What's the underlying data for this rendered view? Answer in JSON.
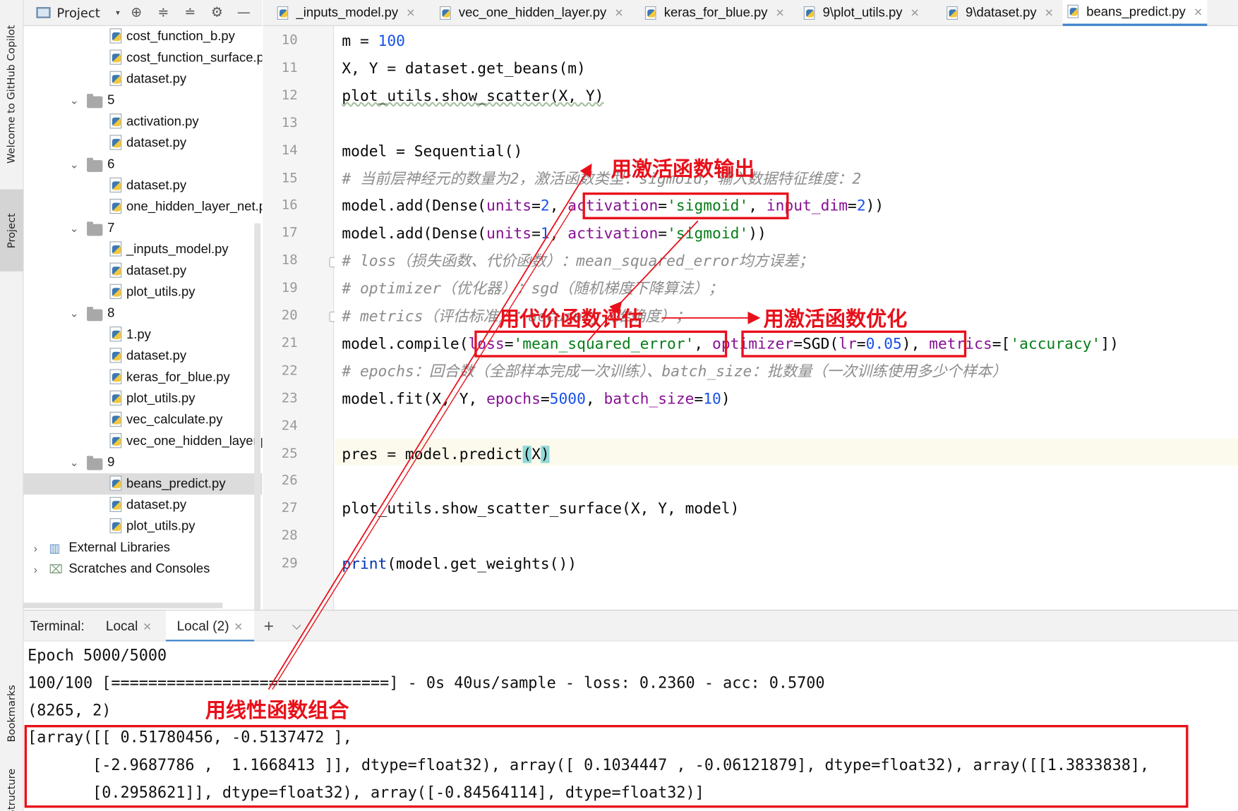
{
  "sidebar_strip": {
    "copilot_label": "Welcome to GitHub Copilot",
    "project_label": "Project",
    "bookmarks_label": "Bookmarks",
    "structure_label": "Structure"
  },
  "project_panel": {
    "title": "Project",
    "toolbar_icons": [
      "crosshair-icon",
      "expand-all-icon",
      "collapse-all-icon",
      "gear-icon",
      "minimize-icon"
    ]
  },
  "tree": [
    {
      "label": "cost_function_b.py",
      "type": "file"
    },
    {
      "label": "cost_function_surface.py",
      "type": "file"
    },
    {
      "label": "dataset.py",
      "type": "file"
    },
    {
      "label": "5",
      "type": "folder"
    },
    {
      "label": "activation.py",
      "type": "file"
    },
    {
      "label": "dataset.py",
      "type": "file"
    },
    {
      "label": "6",
      "type": "folder"
    },
    {
      "label": "dataset.py",
      "type": "file"
    },
    {
      "label": "one_hidden_layer_net.py",
      "type": "file"
    },
    {
      "label": "7",
      "type": "folder"
    },
    {
      "label": "_inputs_model.py",
      "type": "file"
    },
    {
      "label": "dataset.py",
      "type": "file"
    },
    {
      "label": "plot_utils.py",
      "type": "file"
    },
    {
      "label": "8",
      "type": "folder"
    },
    {
      "label": "1.py",
      "type": "file"
    },
    {
      "label": "dataset.py",
      "type": "file"
    },
    {
      "label": "keras_for_blue.py",
      "type": "file"
    },
    {
      "label": "plot_utils.py",
      "type": "file"
    },
    {
      "label": "vec_calculate.py",
      "type": "file"
    },
    {
      "label": "vec_one_hidden_layer.py",
      "type": "file"
    },
    {
      "label": "9",
      "type": "folder"
    },
    {
      "label": "beans_predict.py",
      "type": "file",
      "selected": true
    },
    {
      "label": "dataset.py",
      "type": "file"
    },
    {
      "label": "plot_utils.py",
      "type": "file"
    },
    {
      "label": "External Libraries",
      "type": "library"
    },
    {
      "label": "Scratches and Consoles",
      "type": "scratches"
    }
  ],
  "tabs": [
    {
      "label": "_inputs_model.py",
      "active": false
    },
    {
      "label": "vec_one_hidden_layer.py",
      "active": false
    },
    {
      "label": "keras_for_blue.py",
      "active": false
    },
    {
      "label": "9\\plot_utils.py",
      "active": false
    },
    {
      "label": "9\\dataset.py",
      "active": false
    },
    {
      "label": "beans_predict.py",
      "active": true
    }
  ],
  "editor": {
    "line_numbers": [
      "10",
      "11",
      "12",
      "13",
      "14",
      "15",
      "16",
      "17",
      "18",
      "19",
      "20",
      "21",
      "22",
      "23",
      "24",
      "25",
      "26",
      "27",
      "28",
      "29"
    ],
    "current_line": "25",
    "lines": [
      {
        "text": "m = 100"
      },
      {
        "text": "X, Y = dataset.get_beans(m)"
      },
      {
        "text": "plot_utils.show_scatter(X, Y)"
      },
      {
        "text": ""
      },
      {
        "text": "model = Sequential()"
      },
      {
        "text": "# 当前层神经元的数量为2，激活函数类型：sigmoid，输入数据特征维度：2"
      },
      {
        "text": "model.add(Dense(units=2, activation='sigmoid', input_dim=2))"
      },
      {
        "text": "model.add(Dense(units=1, activation='sigmoid'))"
      },
      {
        "text": "# loss（损失函数、代价函数）：mean_squared_error均方误差；"
      },
      {
        "text": "# optimizer（优化器）：sgd（随机梯度下降算法）；"
      },
      {
        "text": "# metrics（评估标准）：accuracy（准确度）；"
      },
      {
        "text": "model.compile(loss='mean_squared_error', optimizer=SGD(lr=0.05), metrics=['accuracy'])"
      },
      {
        "text": "# epochs：回合数（全部样本完成一次训练）、batch_size：批数量（一次训练使用多少个样本）"
      },
      {
        "text": "model.fit(X, Y, epochs=5000, batch_size=10)"
      },
      {
        "text": ""
      },
      {
        "text": "pres = model.predict(X)"
      },
      {
        "text": ""
      },
      {
        "text": "plot_utils.show_scatter_surface(X, Y, model)"
      },
      {
        "text": ""
      },
      {
        "text": "print(model.get_weights())"
      }
    ]
  },
  "terminal": {
    "label": "Terminal:",
    "tabs": [
      "Local",
      "Local (2)"
    ],
    "active_tab": "Local (2)",
    "add_icon": "plus-icon",
    "dropdown_icon": "chevron-down-icon",
    "lines": [
      "Epoch 5000/5000",
      "100/100 [==============================] - 0s 40us/sample - loss: 0.2360 - acc: 0.5700",
      "(8265, 2)",
      "[array([[ 0.51780456, -0.5137472 ],",
      "       [-2.9687786 ,  1.1668413 ]], dtype=float32), array([ 0.1034447 , -0.06121879], dtype=float32), array([[1.3833838],",
      "       [0.2958621]], dtype=float32), array([-0.84564114], dtype=float32)]"
    ]
  },
  "annotations": {
    "activation_output": "用激活函数输出",
    "cost_eval": "用代价函数评估",
    "activation_optimize": "用激活函数优化",
    "linear_combo": "用线性函数组合",
    "color": "#e8101a"
  }
}
